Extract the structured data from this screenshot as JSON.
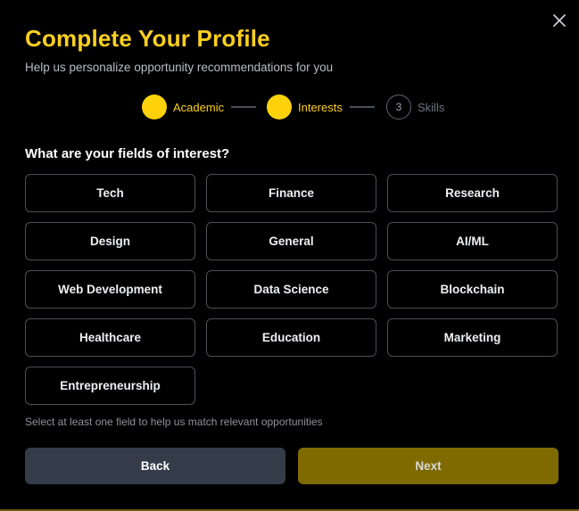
{
  "modal": {
    "title": "Complete Your Profile",
    "subtitle": "Help us personalize opportunity recommendations for you",
    "close_icon": "close-icon"
  },
  "stepper": {
    "steps": [
      {
        "label": "Academic",
        "status": "complete",
        "number": ""
      },
      {
        "label": "Interests",
        "status": "current",
        "number": ""
      },
      {
        "label": "Skills",
        "status": "upcoming",
        "number": "3"
      }
    ]
  },
  "question": "What are your fields of interest?",
  "fields": [
    "Tech",
    "Finance",
    "Research",
    "Design",
    "General",
    "AI/ML",
    "Web Development",
    "Data Science",
    "Blockchain",
    "Healthcare",
    "Education",
    "Marketing",
    "Entrepreneurship"
  ],
  "hint": "Select at least one field to help us match relevant opportunities",
  "buttons": {
    "back": "Back",
    "next": "Next"
  },
  "colors": {
    "accent": "#fccf1f",
    "step_active": "#fdd20a",
    "back_button": "#353c49",
    "next_button": "#7f6a00",
    "chip_border": "#4a4f58"
  }
}
